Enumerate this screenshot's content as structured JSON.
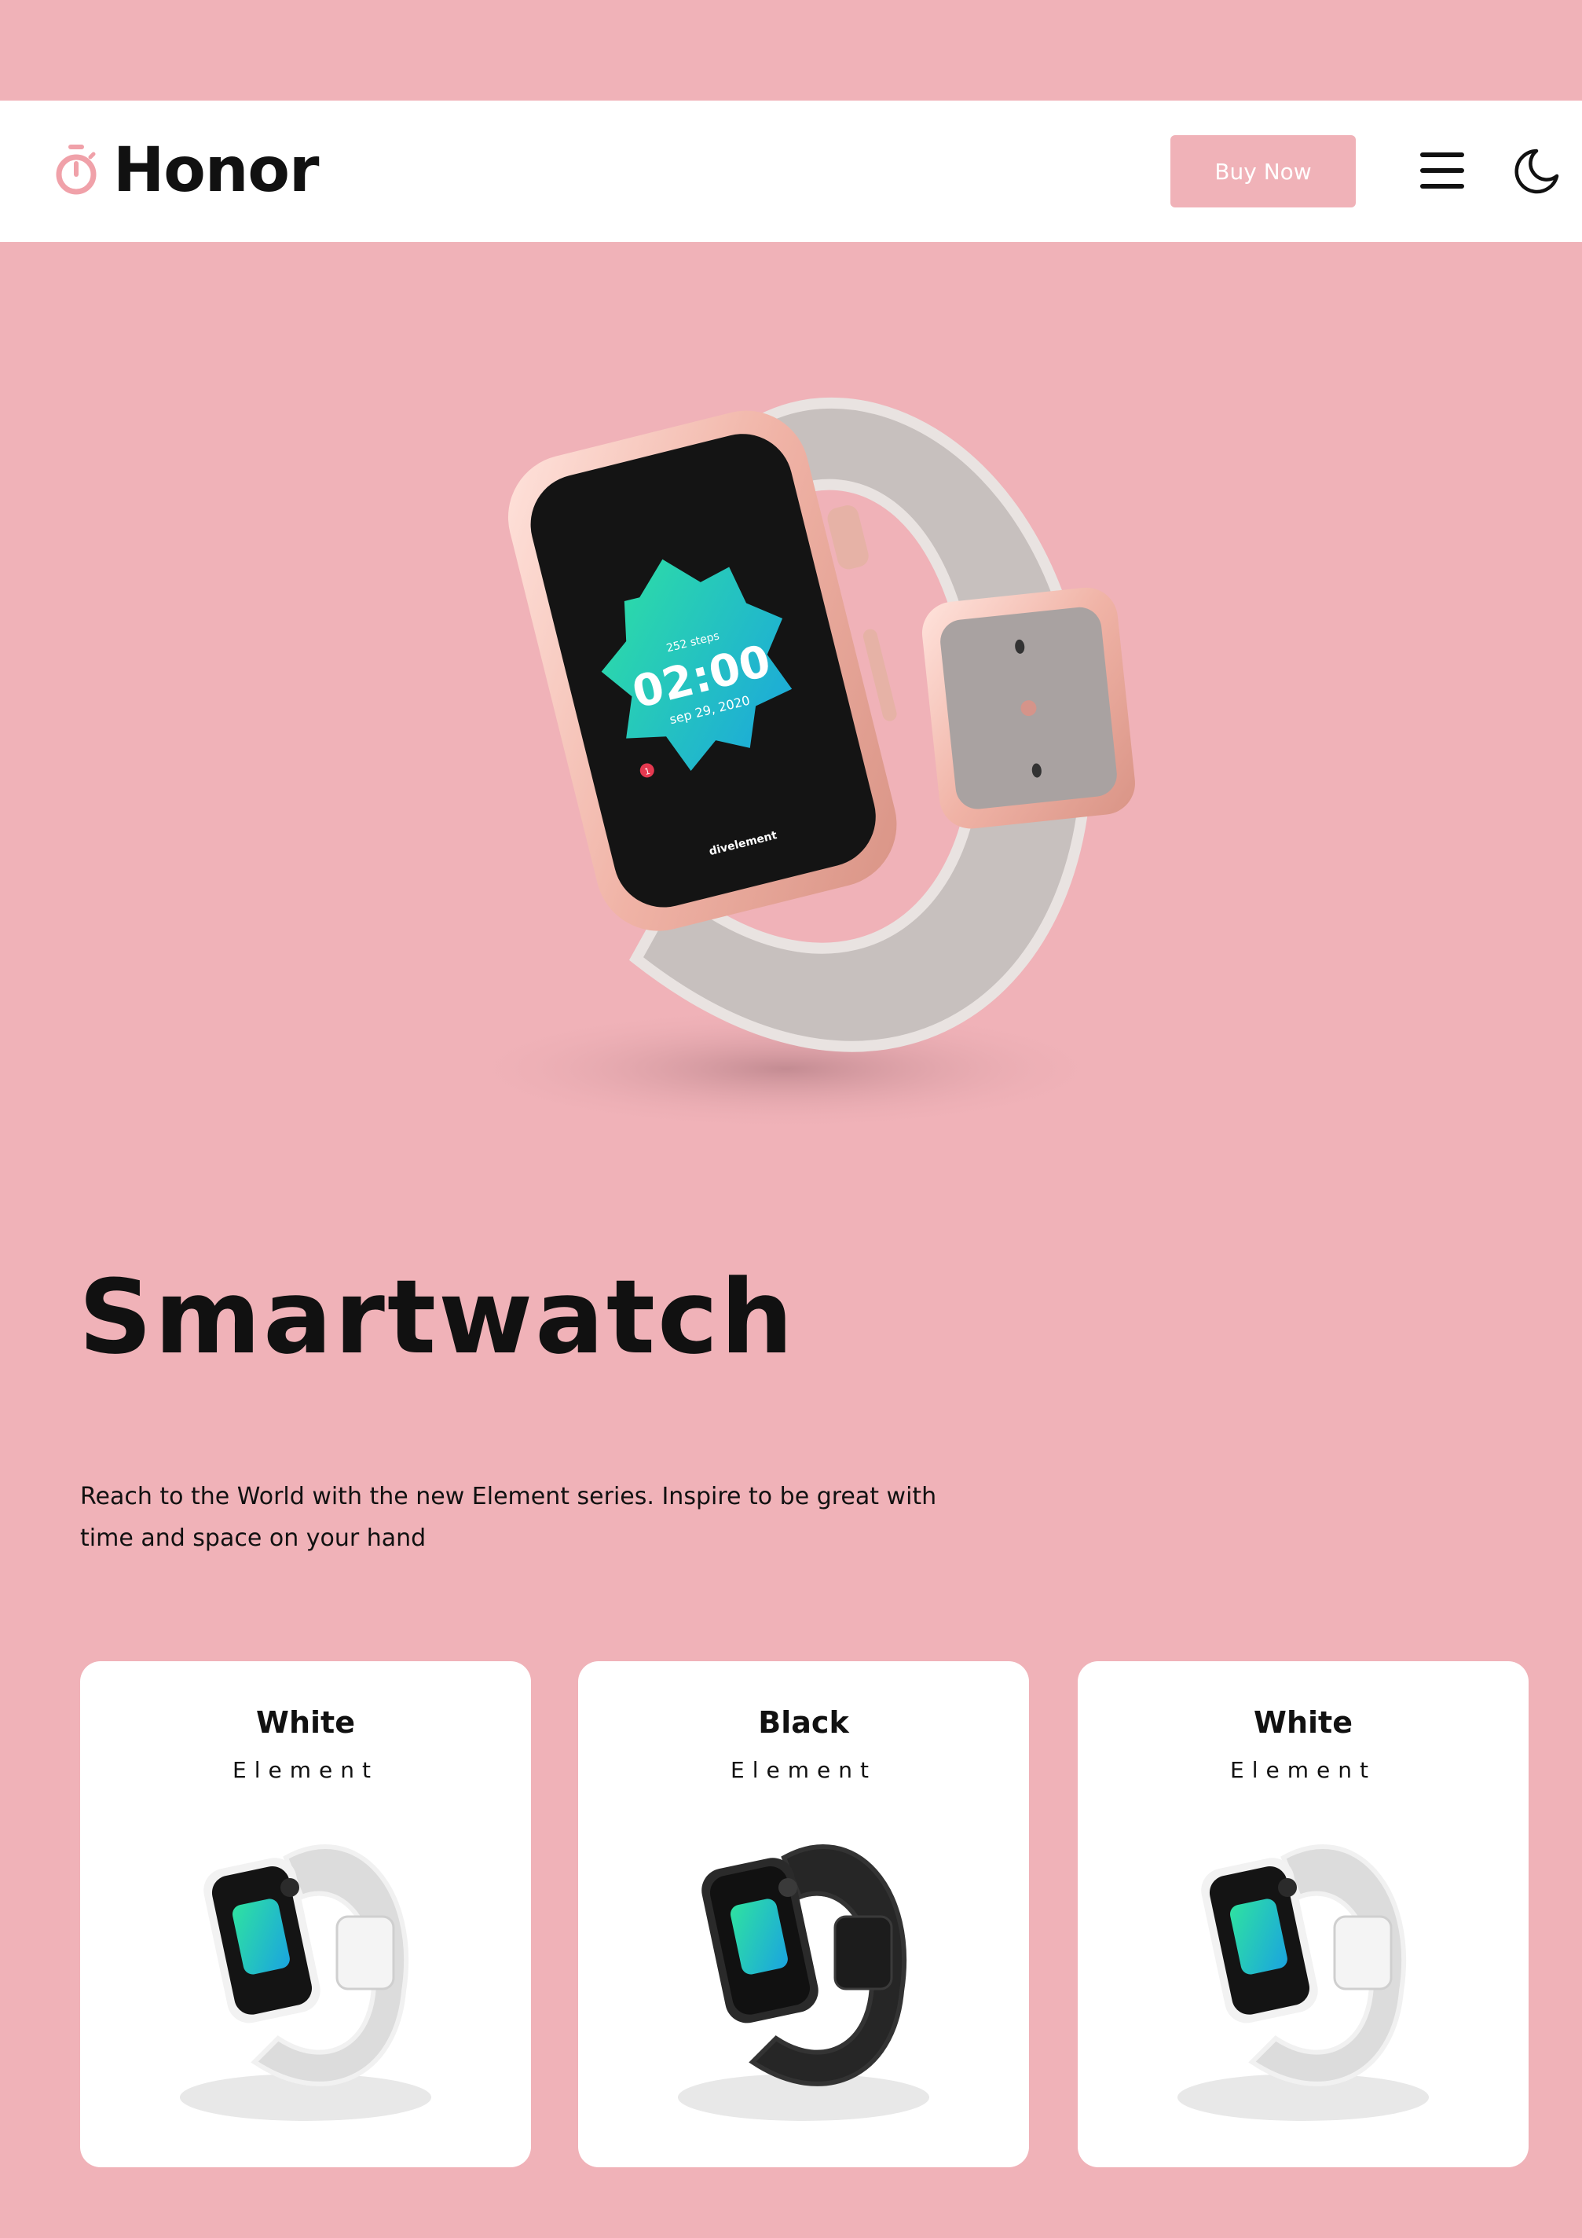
{
  "header": {
    "brand_name": "Honor",
    "buy_label": "Buy Now",
    "icons": [
      "stopwatch-icon",
      "menu-icon",
      "moon-icon"
    ]
  },
  "hero": {
    "title": "Smartwatch",
    "description": "Reach to the World with the new Element series. Inspire to be great with time and space on your hand",
    "watch_screen": {
      "steps": "252 steps",
      "time": "02:00",
      "date": "sep 29, 2020",
      "badge": "1",
      "brand": "divelement"
    }
  },
  "cards": [
    {
      "title": "White",
      "subtitle": "Element",
      "color": "white"
    },
    {
      "title": "Black",
      "subtitle": "Element",
      "color": "black"
    },
    {
      "title": "White",
      "subtitle": "Element",
      "color": "white"
    }
  ],
  "colors": {
    "background": "#f0b2b8",
    "accent": "#f0b2b8",
    "surface": "#ffffff",
    "text": "#111111"
  }
}
